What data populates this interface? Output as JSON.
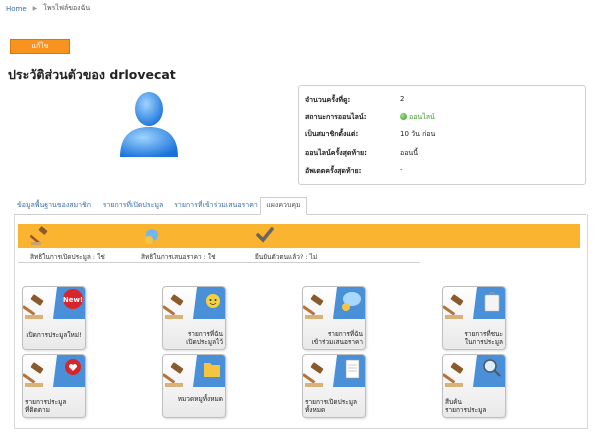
{
  "breadcrumb": {
    "home": "Home",
    "current": "โพรไฟล์ของฉัน"
  },
  "edit_label": "แก้ไข",
  "profile_title": "ประวัติส่วนตัวของ drlovecat",
  "info": [
    {
      "label": "จำนวนครั้งที่ดู:",
      "value": "2"
    },
    {
      "label": "สถานะการออนไลน์:",
      "value": "ออนไลน์"
    },
    {
      "label": "เป็นสมาชิกตั้งแต่:",
      "value": "10 วัน ก่อน"
    },
    {
      "label": "ออนไลน์ครั้งสุดท้าย:",
      "value": "ออนนี้"
    },
    {
      "label": "อัพเดตครั้งสุดท้าย:",
      "value": "-"
    }
  ],
  "tabs": [
    "ข้อมูลพื้นฐานของสมาชิก",
    "รายการที่เปิดประมูล",
    "รายการที่เข้าร่วมเสนอราคา",
    "แผงควบคุม"
  ],
  "rights": [
    {
      "text": "สิทธิในการเปิดประมูล : ใช่",
      "icon": "gavel-icon"
    },
    {
      "text": "สิทธิในการเสนอราคา : ใช่",
      "icon": "bid-icon"
    },
    {
      "text": "ยืนยันตัวตนแล้ว? : ไม่",
      "icon": "checkmark-icon"
    }
  ],
  "tiles": [
    {
      "label": "เปิดการประมูลใหม่!",
      "icon": "new-auction-icon"
    },
    {
      "label": "รายการที่ฉัน\nเปิดประมูลไว้",
      "icon": "my-auctions-icon"
    },
    {
      "label": "รายการที่ฉัน\nเข้าร่วมเสนอราคา",
      "icon": "my-bids-icon"
    },
    {
      "label": "รายการที่ชนะ\nในการประมูล",
      "icon": "won-items-icon"
    },
    {
      "label": "รายการประมูล\nที่ติดตาม",
      "icon": "watchlist-icon"
    },
    {
      "label": "หมวดหมูทั้งหมด",
      "icon": "categories-icon"
    },
    {
      "label": "รายการเปิดประมูล\nทั้งหมด",
      "icon": "all-auctions-icon"
    },
    {
      "label": "สืบค้น\nรายการประมูล",
      "icon": "search-auctions-icon"
    }
  ],
  "new_badge": "New!",
  "colors": {
    "accent": "#f7931e",
    "rights_bar": "#fbb42f",
    "link": "#3a6ea8",
    "online": "#3a9d23"
  }
}
